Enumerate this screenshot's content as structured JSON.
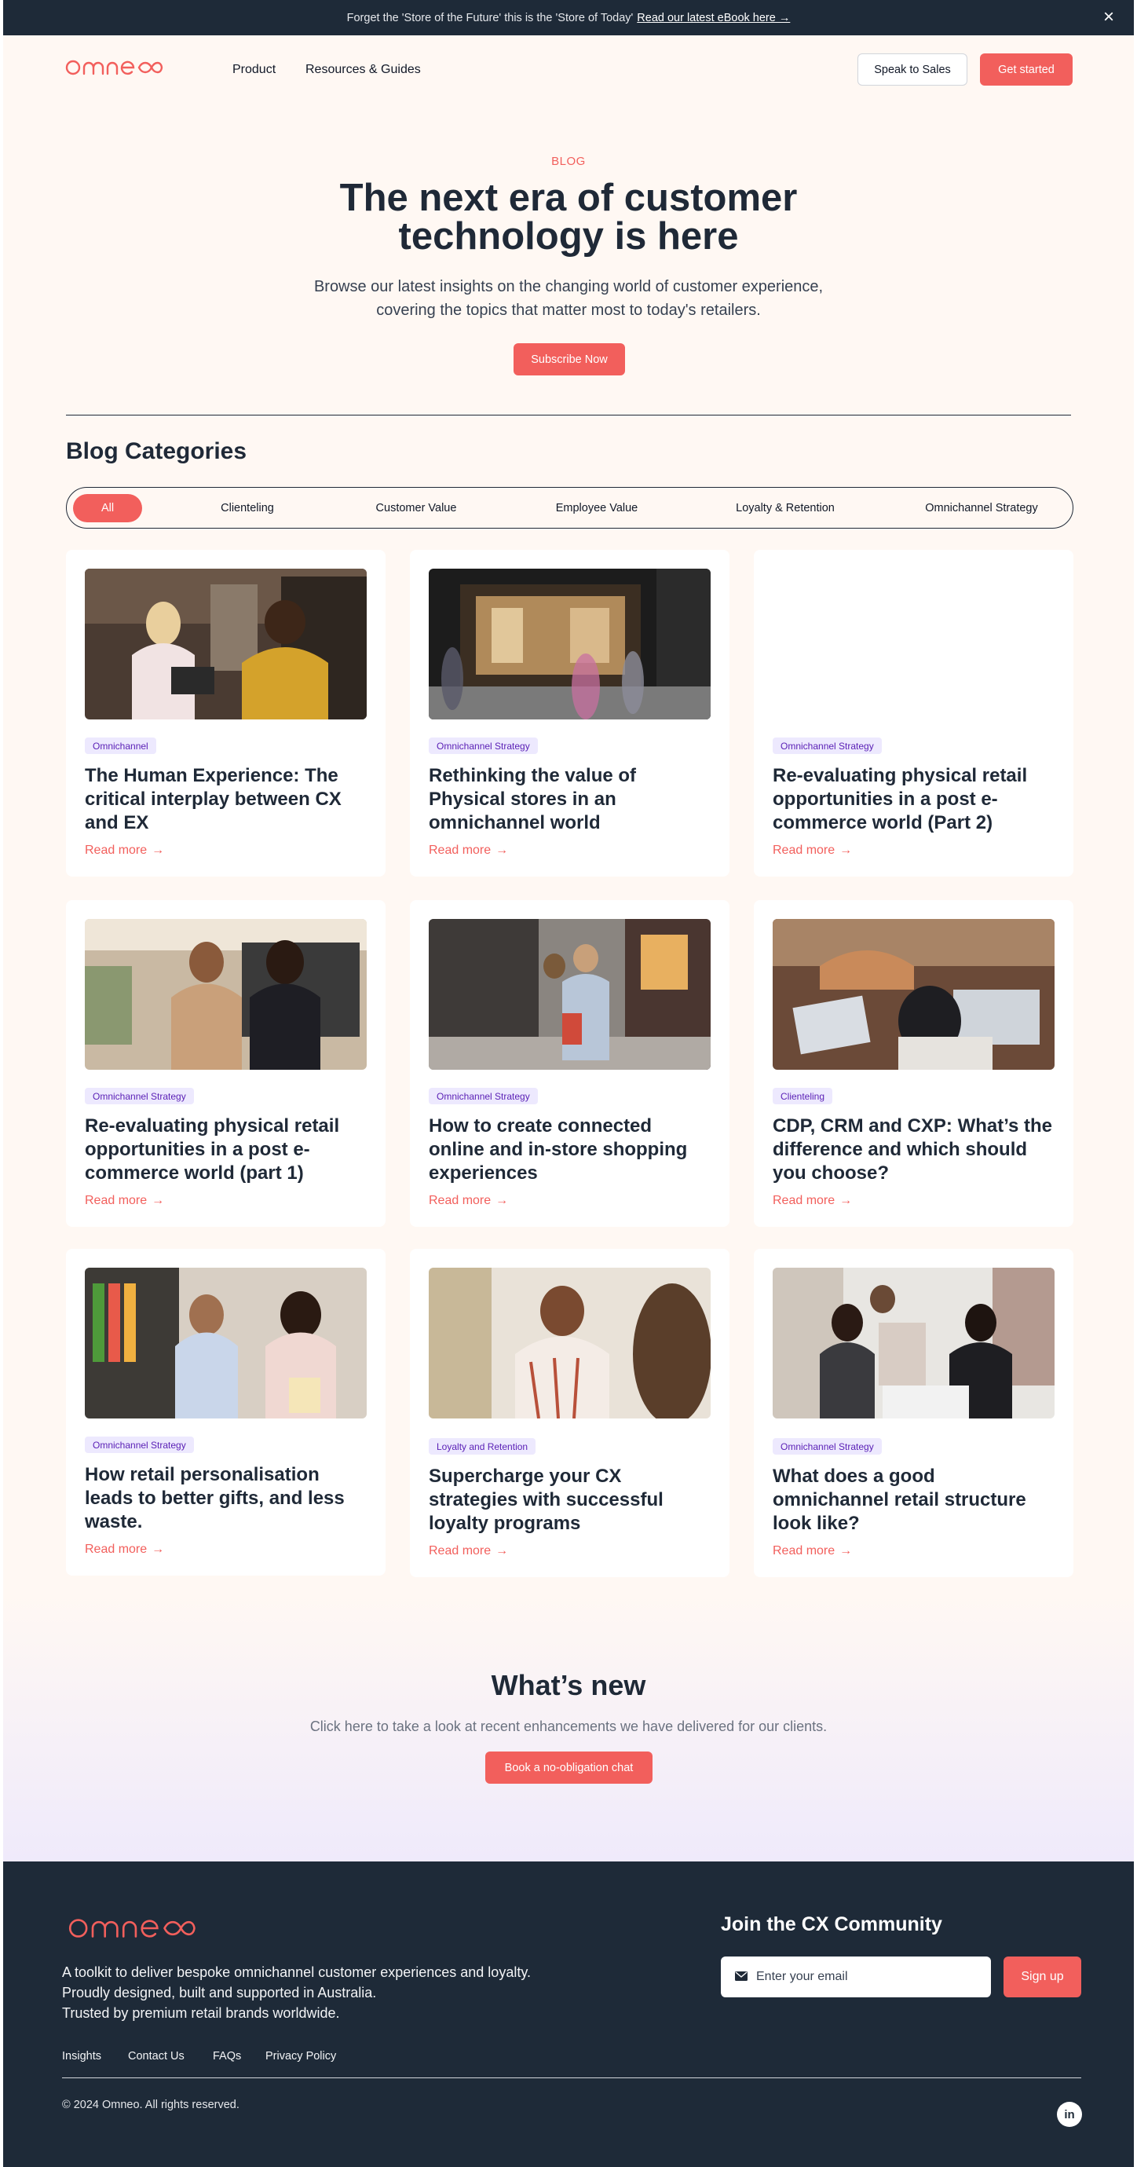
{
  "announcement": {
    "text": "Forget the 'Store of the Future' this is the 'Store of Today'",
    "link": "Read our latest eBook here →"
  },
  "nav": {
    "brand": "omneo",
    "links": [
      "Product",
      "Resources & Guides"
    ],
    "speak_to_sales": "Speak to Sales",
    "get_started": "Get started"
  },
  "hero": {
    "eyebrow": "BLOG",
    "title": "The next era of customer technology is here",
    "subtitle": "Browse our latest insights on the changing world of customer experience, covering the topics that matter most to today's retailers.",
    "cta": "Subscribe Now"
  },
  "categories": {
    "title": "Blog Categories",
    "items": [
      "All",
      "Clienteling",
      "Customer Value",
      "Employee Value",
      "Loyalty & Retention",
      "Omnichannel Strategy"
    ],
    "active": "All"
  },
  "posts": [
    {
      "tag": "Omnichannel",
      "title": "The Human Experience: The critical interplay between CX and EX",
      "read_more": "Read more"
    },
    {
      "tag": "Omnichannel Strategy",
      "title": "Rethinking the value of Physical stores in an omnichannel world",
      "read_more": "Read more"
    },
    {
      "tag": "Omnichannel Strategy",
      "title": "Re-evaluating physical retail opportunities in a post e-commerce world (Part 2)",
      "read_more": "Read more"
    },
    {
      "tag": "Omnichannel Strategy",
      "title": "Re-evaluating physical retail opportunities in a post e-commerce world (part 1)",
      "read_more": "Read more"
    },
    {
      "tag": "Omnichannel Strategy",
      "title": "How to create connected online and in-store shopping experiences",
      "read_more": "Read more"
    },
    {
      "tag": "Clienteling",
      "title": "CDP, CRM and CXP: What’s the difference and which should you choose?",
      "read_more": "Read more"
    },
    {
      "tag": "Omnichannel Strategy",
      "title": "How retail personalisation leads to better gifts, and less waste.",
      "read_more": "Read more"
    },
    {
      "tag": "Loyalty and Retention",
      "title": "Supercharge your CX strategies with successful loyalty programs",
      "read_more": "Read more"
    },
    {
      "tag": "Omnichannel Strategy",
      "title": "What does a good omnichannel retail structure look like?",
      "read_more": "Read more"
    }
  ],
  "whats_new": {
    "title": "What’s new",
    "subtitle": "Click here to take a look at recent enhancements we have delivered for our clients.",
    "cta": "Book a no-obligation chat"
  },
  "footer": {
    "brand": "omneo",
    "description": [
      "A toolkit to deliver bespoke omnichannel customer experiences and loyalty.",
      "Proudly designed, built and supported in Australia.",
      "Trusted by premium retail brands worldwide."
    ],
    "links": [
      "Insights",
      "Contact Us",
      "FAQs",
      "Privacy Policy"
    ],
    "join_title": "Join the CX Community",
    "email_placeholder": "Enter your email",
    "signup": "Sign up",
    "copyright": "© 2024 Omneo. All rights reserved.",
    "social_icon": "linkedin-icon"
  },
  "colors": {
    "accent": "#f25f5c",
    "dark": "#1e2a38",
    "background": "#fff8f3",
    "tag_bg": "#ede9fe",
    "tag_text": "#5b21b6"
  }
}
